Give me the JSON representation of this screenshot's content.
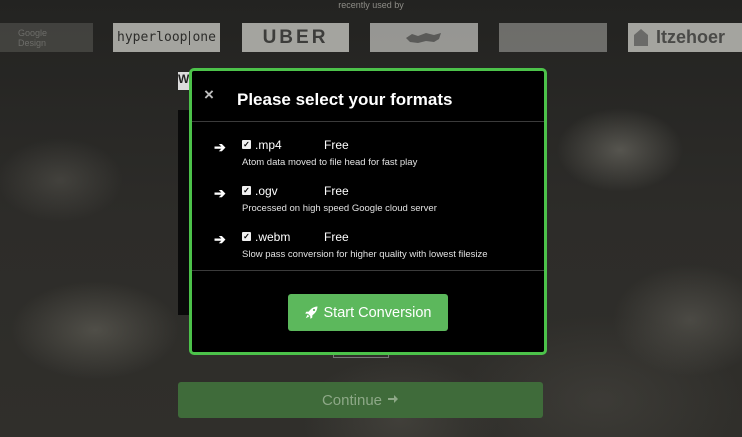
{
  "background": {
    "recently_used_label": "recently used by",
    "logos": [
      {
        "name": "Google Design",
        "text_line1": "Google",
        "text_line2": "Design"
      },
      {
        "name": "hyperloop one",
        "text_a": "hyperloop",
        "text_b": "one"
      },
      {
        "name": "Uber",
        "text": "UBER"
      },
      {
        "name": "animal logo",
        "text": ""
      },
      {
        "name": "faded logo",
        "text": ""
      },
      {
        "name": "Itzehoer",
        "text": "Itzehoer"
      }
    ],
    "w_fragment": "W",
    "continue_label": "Continue",
    "continue_icon": "arrow-right-icon"
  },
  "modal": {
    "close_glyph": "×",
    "title": "Please select your formats",
    "formats": [
      {
        "ext": ".mp4",
        "price": "Free",
        "desc": "Atom data moved to file head for fast play",
        "checked": true
      },
      {
        "ext": ".ogv",
        "price": "Free",
        "desc": "Processed on high speed Google cloud server",
        "checked": true
      },
      {
        "ext": ".webm",
        "price": "Free",
        "desc": "Slow pass conversion for higher quality with lowest filesize",
        "checked": true
      }
    ],
    "start_label": "Start Conversion",
    "start_icon": "rocket-icon",
    "accent_color": "#4cc24a",
    "button_color": "#5cb85c"
  }
}
